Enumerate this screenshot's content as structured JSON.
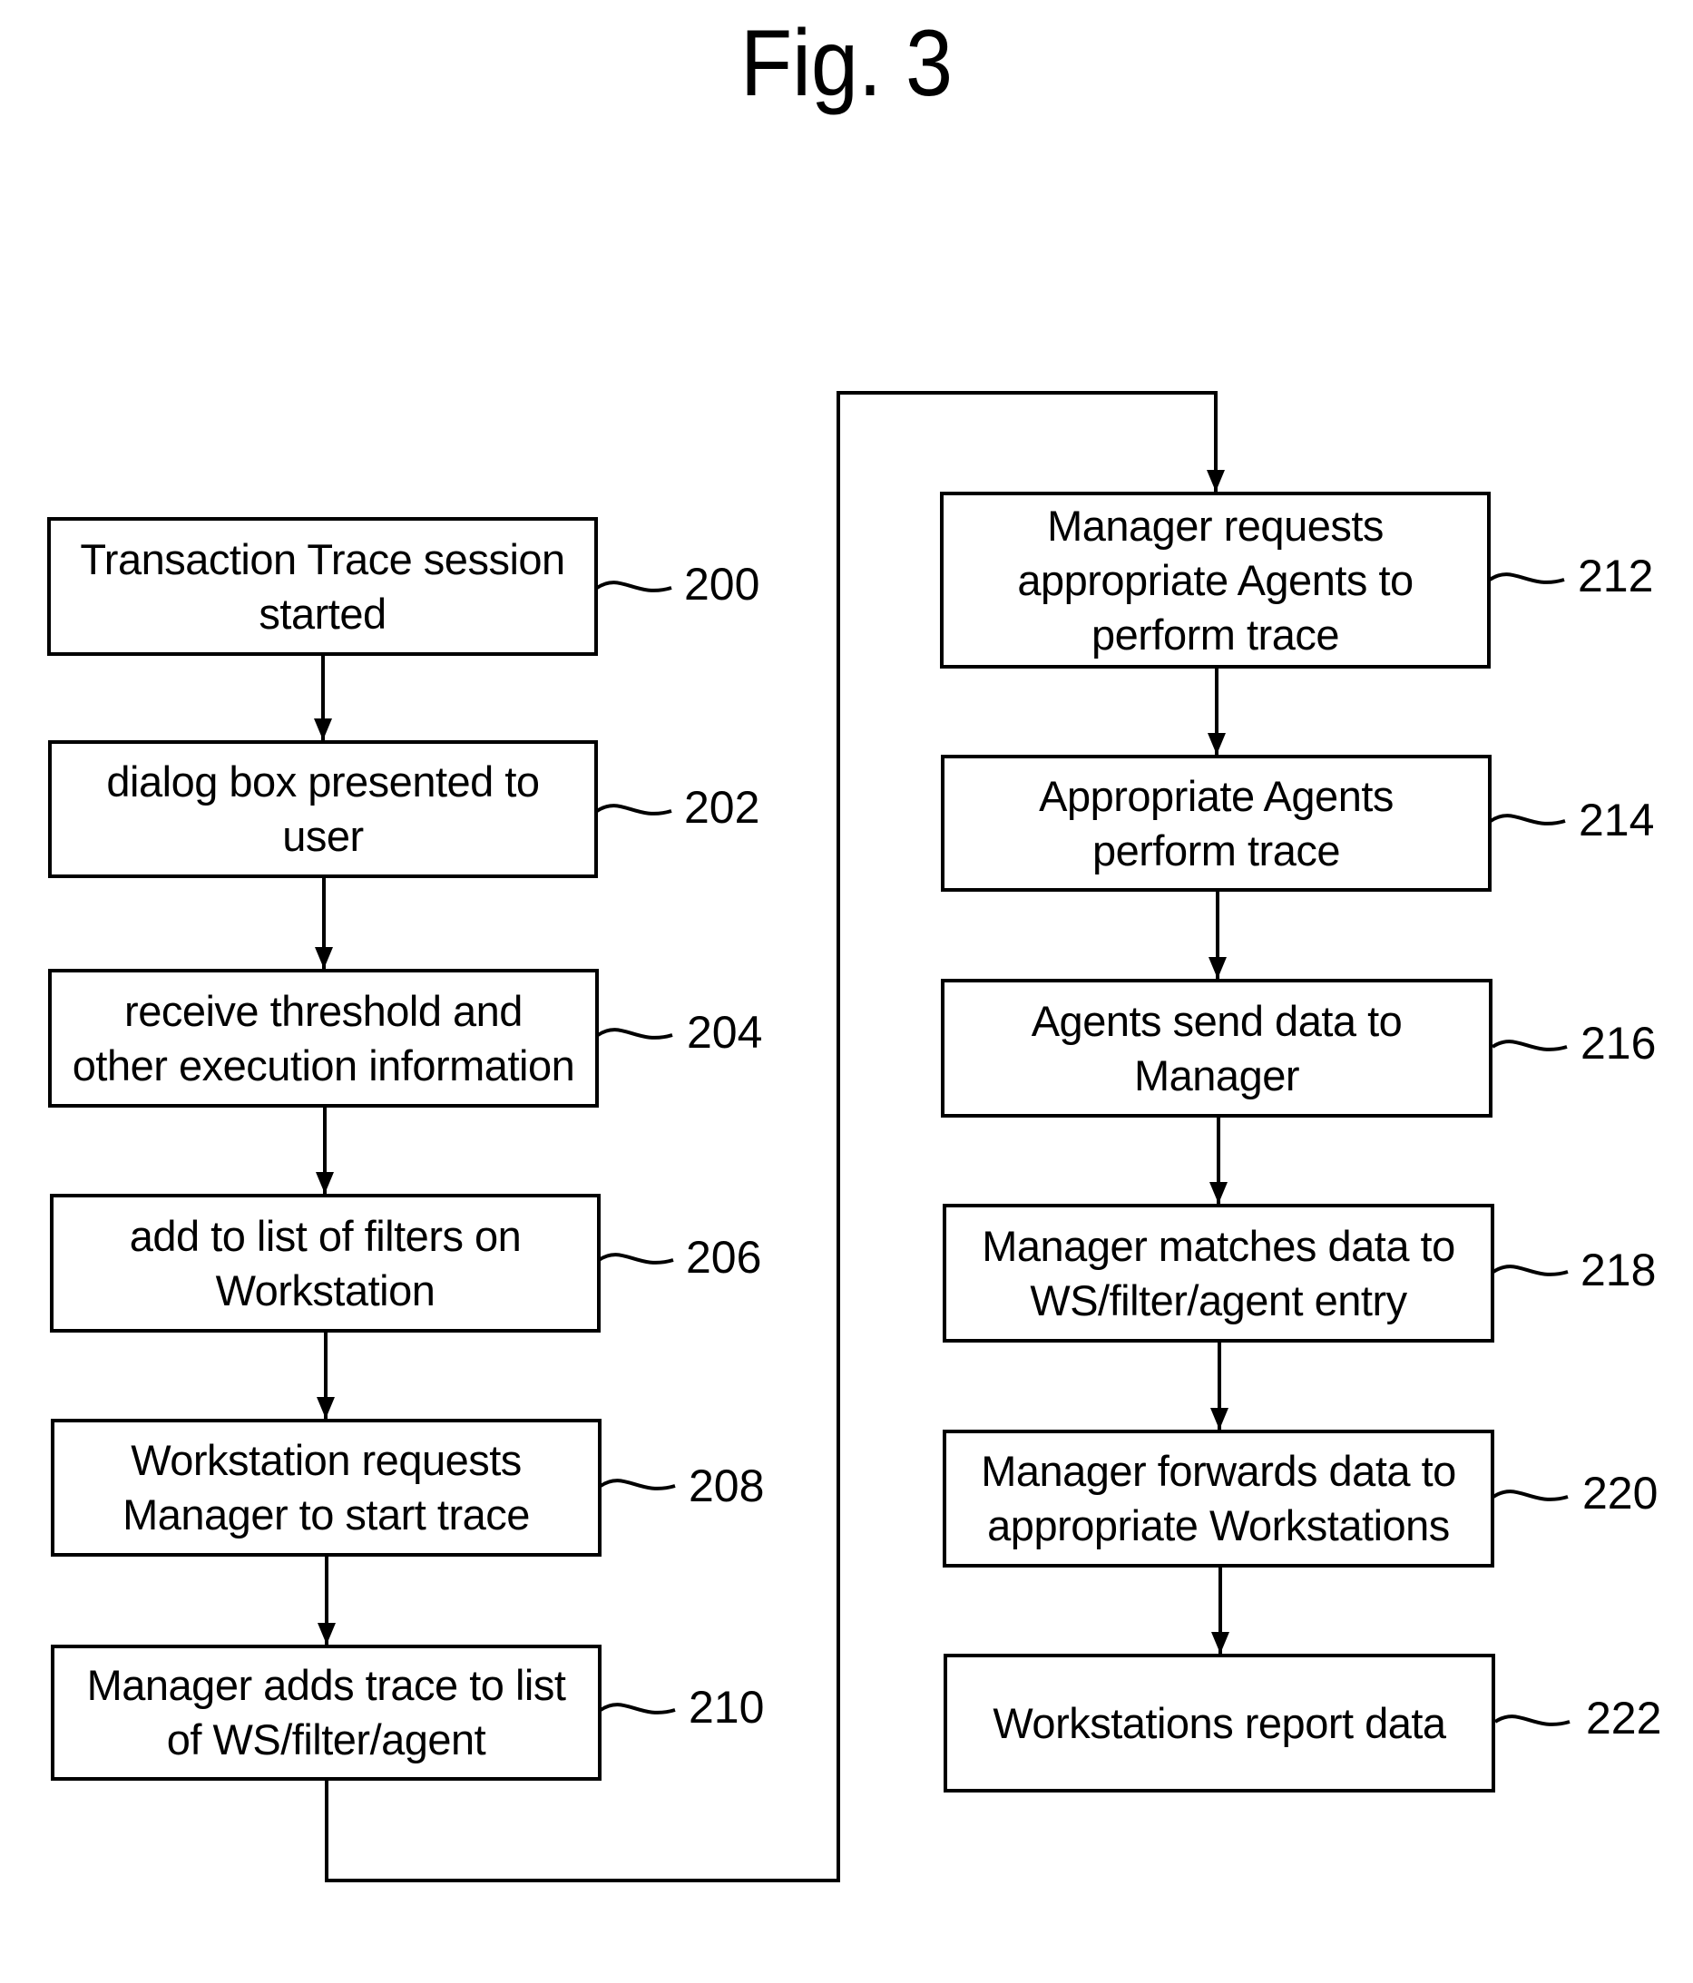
{
  "figure": {
    "title": "Fig. 3",
    "steps": [
      {
        "id": "200",
        "text": "Transaction Trace session\nstarted",
        "ref": "200"
      },
      {
        "id": "202",
        "text": "dialog box presented to\nuser",
        "ref": "202"
      },
      {
        "id": "204",
        "text": "receive threshold and\nother execution information",
        "ref": "204"
      },
      {
        "id": "206",
        "text": "add to list of filters on\nWorkstation",
        "ref": "206"
      },
      {
        "id": "208",
        "text": "Workstation requests\nManager to start trace",
        "ref": "208"
      },
      {
        "id": "210",
        "text": "Manager adds trace to list\nof WS/filter/agent",
        "ref": "210"
      },
      {
        "id": "212",
        "text": "Manager requests\nappropriate Agents to\nperform trace",
        "ref": "212"
      },
      {
        "id": "214",
        "text": "Appropriate Agents\nperform trace",
        "ref": "214"
      },
      {
        "id": "216",
        "text": "Agents send data to\nManager",
        "ref": "216"
      },
      {
        "id": "218",
        "text": "Manager matches data to\nWS/filter/agent entry",
        "ref": "218"
      },
      {
        "id": "220",
        "text": "Manager forwards data to\nappropriate Workstations",
        "ref": "220"
      },
      {
        "id": "222",
        "text": "Workstations report data",
        "ref": "222"
      }
    ],
    "flow": [
      "200",
      "202",
      "204",
      "206",
      "208",
      "210",
      "212",
      "214",
      "216",
      "218",
      "220",
      "222"
    ]
  }
}
